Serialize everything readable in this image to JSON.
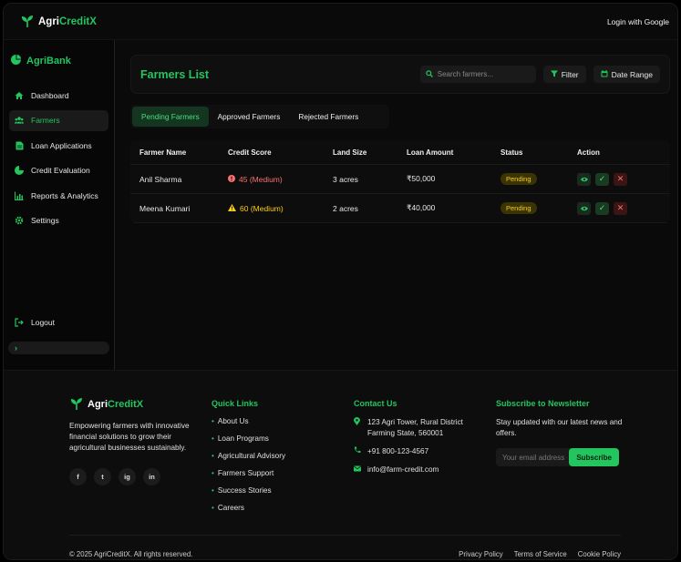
{
  "app": {
    "brand_prefix": "Agri",
    "brand_suffix": "CreditX",
    "login_label": "Login with Google"
  },
  "sidebar": {
    "brand": "AgriBank",
    "items": [
      {
        "label": "Dashboard",
        "icon": "home-icon"
      },
      {
        "label": "Farmers",
        "icon": "users-icon"
      },
      {
        "label": "Loan Applications",
        "icon": "document-icon"
      },
      {
        "label": "Credit Evaluation",
        "icon": "pie-chart-icon"
      },
      {
        "label": "Reports & Analytics",
        "icon": "bar-chart-icon"
      },
      {
        "label": "Settings",
        "icon": "gear-icon"
      }
    ],
    "active_item": "Farmers",
    "logout_label": "Logout"
  },
  "header": {
    "title": "Farmers List",
    "search_placeholder": "Search farmers...",
    "filter_label": "Filter",
    "date_range_label": "Date Range"
  },
  "tabs": [
    {
      "label": "Pending Farmers",
      "active": true
    },
    {
      "label": "Approved Farmers",
      "active": false
    },
    {
      "label": "Rejected Farmers",
      "active": false
    }
  ],
  "table": {
    "columns": [
      "Farmer Name",
      "Credit Score",
      "Land Size",
      "Loan Amount",
      "Status",
      "Action"
    ],
    "rows": [
      {
        "name": "Anil Sharma",
        "score": "45 (Medium)",
        "score_icon": "alert-circle-icon",
        "land": "3 acres",
        "loan": "₹50,000",
        "status": "Pending"
      },
      {
        "name": "Meena Kumari",
        "score": "60 (Medium)",
        "score_icon": "warning-triangle-icon",
        "land": "2 acres",
        "loan": "₹40,000",
        "status": "Pending"
      }
    ]
  },
  "footer": {
    "brand_prefix": "Agri",
    "brand_suffix": "CreditX",
    "about": "Empowering farmers with innovative financial solutions to grow their agricultural businesses sustainably.",
    "socials": [
      "f",
      "t",
      "ig",
      "in"
    ],
    "quick_links_title": "Quick Links",
    "quick_links": [
      "About Us",
      "Loan Programs",
      "Agricultural Advisory",
      "Farmers Support",
      "Success Stories",
      "Careers"
    ],
    "contact_title": "Contact Us",
    "address": "123 Agri Tower, Rural District Farming State, 560001",
    "phone": "+91 800-123-4567",
    "email": "info@farm-credit.com",
    "newsletter_title": "Subscribe to Newsletter",
    "newsletter_text": "Stay updated with our latest news and offers.",
    "newsletter_placeholder": "Your email address",
    "subscribe_label": "Subscribe",
    "copyright": "© 2025 AgriCreditX. All rights reserved.",
    "legal": [
      "Privacy Policy",
      "Terms of Service",
      "Cookie Policy"
    ]
  },
  "colors": {
    "accent": "#22c55e",
    "background": "#0a0a0a",
    "pending": "#facc15",
    "danger": "#f87171"
  }
}
